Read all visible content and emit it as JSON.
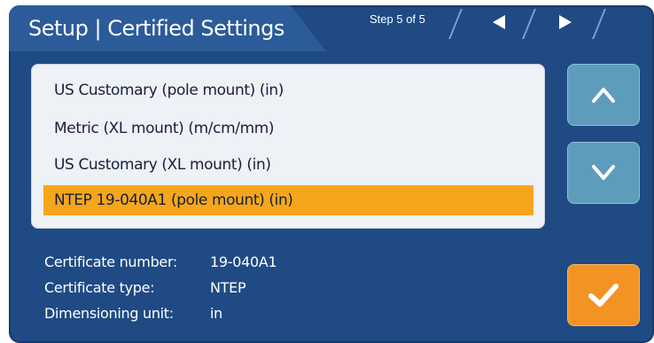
{
  "header": {
    "title": "Setup | Certified Settings",
    "step": "Step 5 of 5",
    "prev_icon": "triangle-left-icon",
    "next_icon": "triangle-right-icon"
  },
  "unit_list": {
    "items": [
      {
        "label": "US Customary (pole mount) (in)",
        "selected": false
      },
      {
        "label": "Metric (XL mount) (m/cm/mm)",
        "selected": false
      },
      {
        "label": "US Customary (XL mount) (in)",
        "selected": false
      },
      {
        "label": "NTEP 19-040A1 (pole mount) (in)",
        "selected": true
      }
    ]
  },
  "scroll": {
    "up_icon": "chevron-up-icon",
    "down_icon": "chevron-down-icon"
  },
  "details": {
    "certificate_number_label": "Certificate number:",
    "certificate_number_value": "19-040A1",
    "certificate_type_label": "Certificate type:",
    "certificate_type_value": "NTEP",
    "dimensioning_unit_label": "Dimensioning unit:",
    "dimensioning_unit_value": "in"
  },
  "confirm": {
    "icon": "checkmark-icon"
  },
  "colors": {
    "panel": "#1f4a84",
    "header_tab": "#2c5b9a",
    "selected": "#f6a61d",
    "scroll_button": "#5e9cbb",
    "confirm_button": "#f39324"
  }
}
